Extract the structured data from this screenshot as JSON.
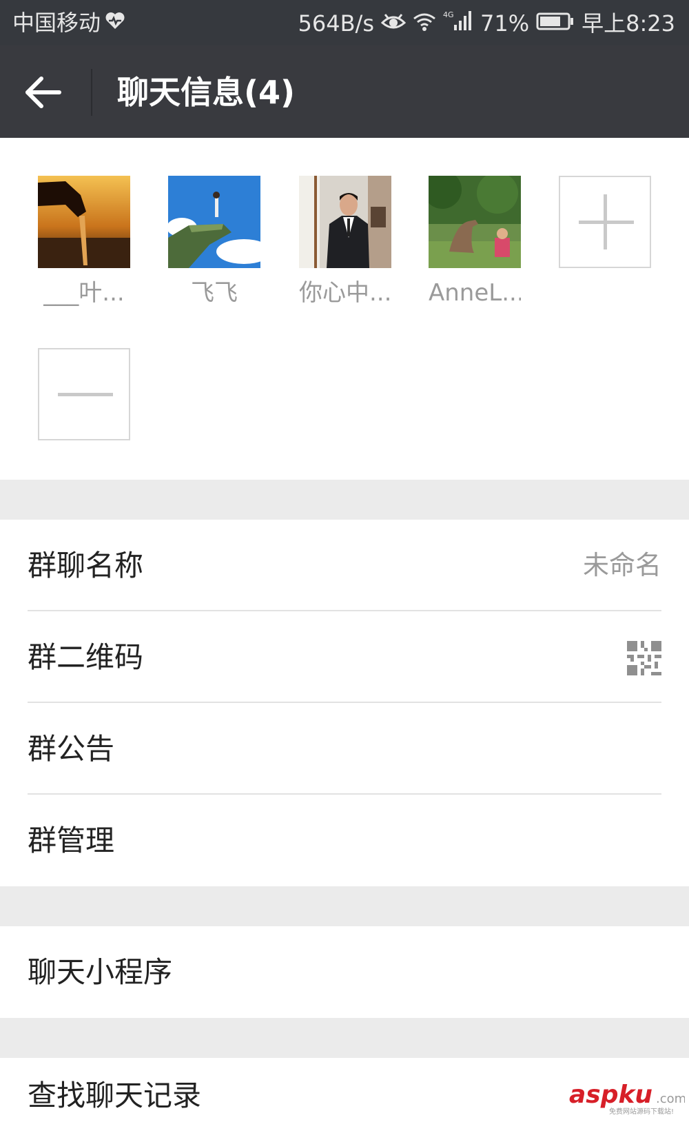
{
  "status_bar": {
    "carrier": "中国移动",
    "net_speed": "564B/s",
    "network_type": "4G",
    "battery": "71%",
    "time": "早上8:23"
  },
  "header": {
    "back_icon": "arrow-left-icon",
    "title": "聊天信息(4)"
  },
  "members": [
    {
      "name": "___叶..."
    },
    {
      "name": "飞飞"
    },
    {
      "name": "你心中..."
    },
    {
      "name": "AnneL..."
    }
  ],
  "member_actions": {
    "add_icon": "plus-icon",
    "remove_icon": "minus-icon"
  },
  "settings_group_1": [
    {
      "label": "群聊名称",
      "value": "未命名"
    },
    {
      "label": "群二维码",
      "icon": "qr-code-icon"
    },
    {
      "label": "群公告"
    },
    {
      "label": "群管理"
    }
  ],
  "settings_group_2": [
    {
      "label": "聊天小程序"
    }
  ],
  "settings_group_3": [
    {
      "label": "查找聊天记录"
    }
  ],
  "watermark": {
    "brand": "aspku",
    "suffix": ".com",
    "tagline": "免费网站源码下载站!"
  },
  "colors": {
    "status_bar_bg": "#36393e",
    "title_bar_bg": "#393a3f",
    "page_bg": "#ebebeb",
    "watermark_red": "#d71f28"
  }
}
